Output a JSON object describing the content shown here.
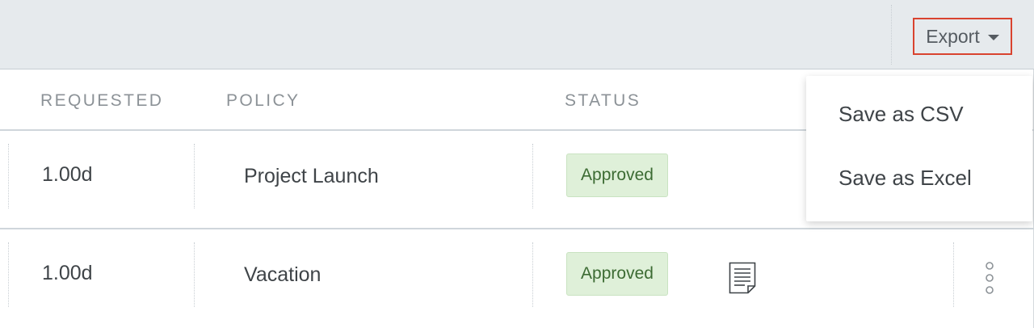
{
  "toolbar": {
    "export_label": "Export"
  },
  "table": {
    "columns": [
      "REQUESTED",
      "POLICY",
      "STATUS"
    ],
    "rows": [
      {
        "requested": "1.00d",
        "policy": "Project Launch",
        "status": "Approved"
      },
      {
        "requested": "1.00d",
        "policy": "Vacation",
        "status": "Approved"
      }
    ]
  },
  "export_menu": {
    "items": [
      "Save as CSV",
      "Save as Excel"
    ]
  },
  "colors": {
    "approved_bg": "#dff0d9",
    "approved_text": "#3c6b33",
    "export_highlight": "#d9432f",
    "toolbar_bg": "#e6eaed"
  },
  "icons": {
    "export_caret": "chevron-down-icon",
    "notes": "document-icon",
    "row_menu": "more-vertical-icon"
  }
}
